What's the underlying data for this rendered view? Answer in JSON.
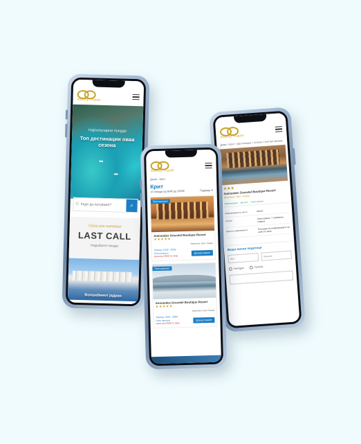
{
  "brand": {
    "logo_text": "Infinity Travel"
  },
  "phone1": {
    "hero_subtitle": "Најпопуларни понуди",
    "hero_title": "Топ дестинации оваа сезона",
    "search_placeholder": "Каде да патуваме?",
    "lastcall_kicker": "Сега или никогаш",
    "lastcall_title": "LAST CALL",
    "lastcall_subtitle": "Најдобрите понуди",
    "promo_caption": "Волшебниот јадран"
  },
  "phone2": {
    "breadcrumb": [
      "Дома",
      "Крит"
    ],
    "title": "Крит",
    "result_count": "10 понуди од 600€ до 2500€",
    "sort_label": "Подреди",
    "hotels": [
      {
        "badge": "Препорачано",
        "name": "Amirandes Grecotel Boutique Resort",
        "stars": "★★★★★",
        "line1": "Период: 15/06 - 30/09",
        "line2": "Полн пансион",
        "line3": "Цена од 1200€ по лице",
        "loc": "Ираклион, Крит, Грција",
        "button": "Дознај повеќе"
      },
      {
        "badge": "Препорачано",
        "name": "Amirandes Grecotel Boutique Resort",
        "stars": "★★★★★",
        "line1": "Период: 15/06 - 30/09",
        "line2": "Полн пансион",
        "line3": "Цена од 1200€ по лице",
        "loc": "Ираклион, Крит, Грција",
        "button": "Дознај повеќе"
      }
    ]
  },
  "phone3": {
    "breadcrumb": "Дома > Крит > Дестинации > Хотели > Контакт форма",
    "stars": "★★★",
    "hotel_name": "Amirandes Grecotel Boutique Resort",
    "hotel_location": "Ираклион, Крит, Грција",
    "tabs": [
      "Информации",
      "Детали",
      "Сместување"
    ],
    "table": [
      {
        "k": "Информации за патот",
        "v": "Авион"
      },
      {
        "k": "Услуга",
        "v": "Сместување, 7 ноќевања, појадок"
      },
      {
        "k": "Цена на аранжманот",
        "v": "Погледни во информациите за цени по лице"
      }
    ],
    "section_title": "Ваши лични податоци",
    "input1": "Име",
    "input2": "Презиме",
    "radio1": "Господин",
    "radio2": "Госпоѓа"
  }
}
